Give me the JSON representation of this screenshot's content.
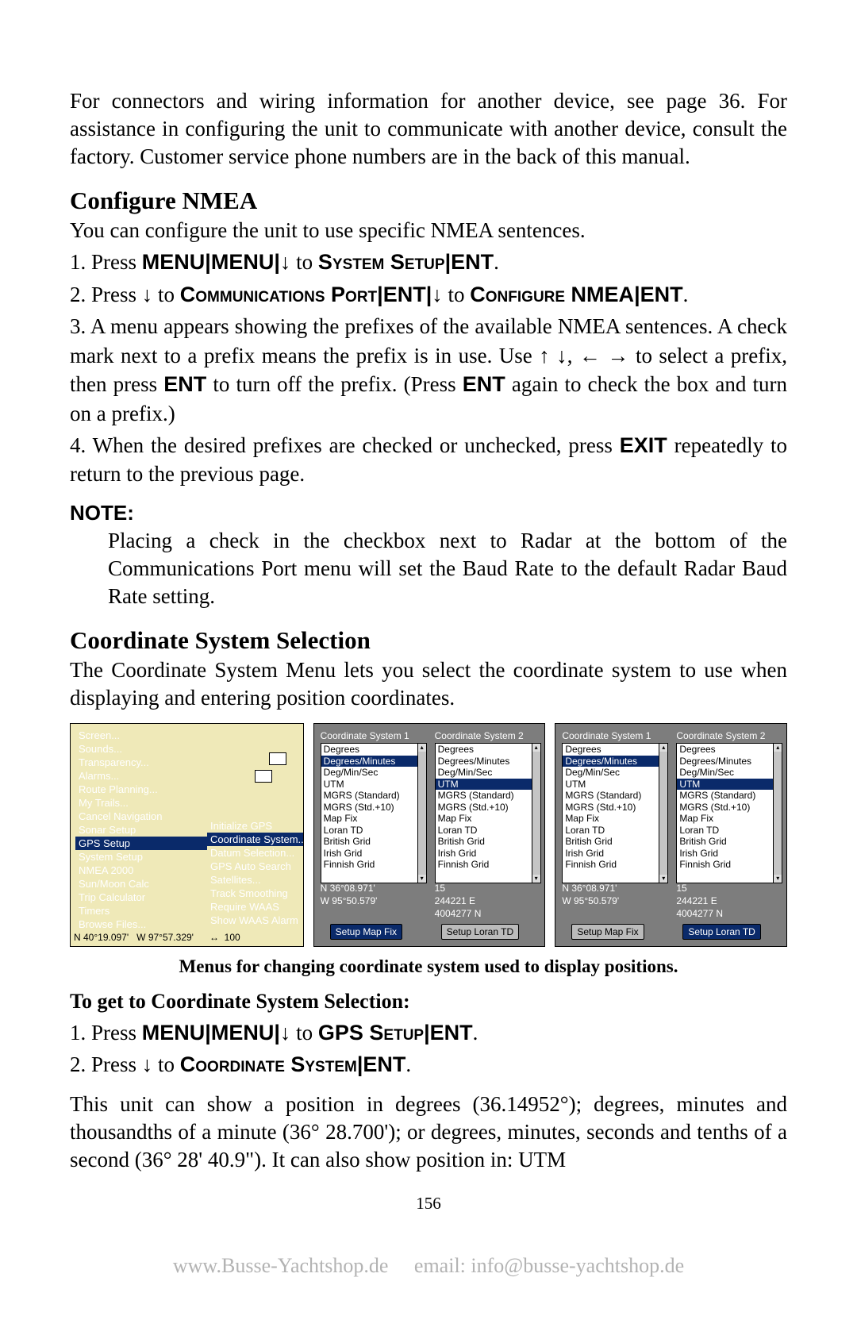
{
  "intro": "For connectors and wiring information for another device, see page 36. For assistance in configuring the unit to communicate with another device, consult the factory. Customer service phone numbers are in the back of this manual.",
  "h_configure": "Configure NMEA",
  "p_configure": "You can configure the unit to use specific NMEA sentences.",
  "step1_a": "1. Press ",
  "step1_b": "MENU",
  "step1_pipe": "|",
  "step1_c": "MENU",
  "step1_d": " to ",
  "step1_e": "System Setup",
  "step1_f": "ENT",
  "step1_dot": ".",
  "step2_a": "2. Press ",
  "step2_b": " to ",
  "step2_c": "Communications Port",
  "step2_d": "ENT",
  "step2_e": "Configure NMEA",
  "step2_f": "ENT",
  "step3_a": "3. A menu appears showing the prefixes of the available NMEA sentences. A check mark next to a prefix means the prefix is in use. Use ",
  "step3_b": "  to select a prefix, then press ",
  "step3_c": " to turn off the prefix. (Press ",
  "step3_d": " again to check the box and turn on a prefix.)",
  "step3_ent": "ENT",
  "step4_a": "4. When the desired prefixes are checked or unchecked, press ",
  "step4_b": " repeatedly to return to the previous page.",
  "step4_exit": "EXIT",
  "note_label": "NOTE:",
  "note_body": "Placing a check in the checkbox next to Radar at the bottom of the Communications Port menu will set the Baud Rate to the default Radar Baud Rate setting.",
  "h_coord": "Coordinate System Selection",
  "p_coord": "The Coordinate System Menu lets you select the coordinate system to use when displaying and entering position coordinates.",
  "menu_items": [
    "Screen...",
    "Sounds...",
    "Transparency...",
    "Alarms...",
    "Route Planning...",
    "My Trails...",
    "Cancel Navigation",
    "Sonar Setup",
    "GPS Setup",
    "System Setup",
    "NMEA 2000",
    "Sun/Moon Calc",
    "Trip Calculator",
    "Timers",
    "Browse Files..."
  ],
  "menu_sel": "GPS Setup",
  "sub_items": [
    "Initialize GPS",
    "Coordinate System...",
    "Datum Selection...",
    "GPS Auto Search",
    "Satellites...",
    "Track Smoothing",
    "Require WAAS",
    "Show WAAS Alarm"
  ],
  "sub_sel": "Coordinate System...",
  "fig1_footer_left": "N   40°19.097'",
  "fig1_footer_mid": "W   97°57.329'",
  "fig1_footer_right": "100",
  "col_hdr1": "Coordinate System 1",
  "col_hdr2": "Coordinate System 2",
  "opts": [
    "Degrees",
    "Degrees/Minutes",
    "Deg/Min/Sec",
    "UTM",
    "MGRS (Standard)",
    "MGRS (Std.+10)",
    "Map Fix",
    "Loran TD",
    "British Grid",
    "Irish Grid",
    "Finnish Grid"
  ],
  "fig2_sel1": "Degrees/Minutes",
  "fig2_sel2": "UTM",
  "fig3_sel1": "Degrees/Minutes",
  "fig3_sel2": "UTM",
  "coord_n": "N   36°08.971'",
  "coord_w": "W   95°50.579'",
  "coord_15": "15",
  "coord_e": "244221 E",
  "coord_n2": "4004277 N",
  "btn_mapfix": "Setup Map Fix",
  "btn_lorantd": "Setup Loran TD",
  "caption": "Menus for changing coordinate system used to display positions.",
  "subhead": "To get to Coordinate System Selection:",
  "g1_a": "1. Press ",
  "g1_gps": "GPS Setup",
  "g2_a": "2. Press ",
  "g2_cs": "Coordinate System",
  "tail": "This unit can show a position in degrees (36.14952°); degrees, minutes and thousandths of a minute (36° 28.700'); or degrees, minutes, seconds and tenths of a second (36° 28' 40.9\"). It can also show position in: UTM",
  "pagenum": "156",
  "footer_url": "www.Busse-Yachtshop.de",
  "footer_email": "email: info@busse-yachtshop.de",
  "arrows": {
    "down": "↓",
    "up": "↑",
    "left": "←",
    "right": "→",
    "lr": "↔"
  }
}
